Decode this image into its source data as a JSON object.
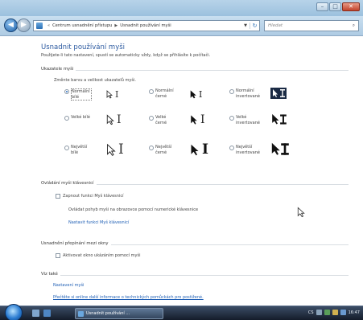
{
  "window": {
    "controls": {
      "minimize": "–",
      "maximize": "□",
      "close": "✕"
    }
  },
  "navbar": {
    "breadcrumb": [
      "Centrum usnadnění přístupu",
      "Usnadnit používání myši"
    ],
    "search_placeholder": "Hledat",
    "search_icon": "search-icon"
  },
  "page": {
    "title": "Usnadnit používání myši",
    "lead": "Použijete-li tato nastavení, spustí se automaticky vždy, když se přihlásíte k počítači.",
    "pointers_group": "Ukazatele myši",
    "pointers_sub": "Změnte barvu a velikost ukazatelů myši.",
    "pointer_options": [
      {
        "label": "Normální bílé",
        "selected": true
      },
      {
        "label": "Normální černé",
        "selected": false
      },
      {
        "label": "Normální invertované",
        "selected": false
      },
      {
        "label": "Velké bílé",
        "selected": false
      },
      {
        "label": "Velké černé",
        "selected": false
      },
      {
        "label": "Velké invertované",
        "selected": false
      },
      {
        "label": "Největší bílé",
        "selected": false
      },
      {
        "label": "Největší černé",
        "selected": false
      },
      {
        "label": "Největší invertované",
        "selected": false
      }
    ],
    "keys_group": "Ovládání myši klávesnicí",
    "keys_checkbox": "Zapnout funkci Myš klávesnicí",
    "keys_desc": "Ovládat pohyb myši na obrazovce pomocí numerické klávesnice",
    "keys_link": "Nastavit funkci Myš klávesnicí",
    "windows_group": "Usnadnění přepínání mezi okny",
    "windows_checkbox": "Aktivovat okno ukázáním pomocí myši",
    "see_also_group": "Viz také",
    "see_also_link1": "Nastavení myši",
    "see_also_link2": "Přečtěte si online další informace o technických pomůckách pro postižené."
  },
  "taskbar": {
    "task_label": "Usnadnit používání ...",
    "clock": "16:47",
    "lang": "CS"
  },
  "colors": {
    "title_blue": "#2c5aa0",
    "link_blue": "#1f5fb5"
  }
}
